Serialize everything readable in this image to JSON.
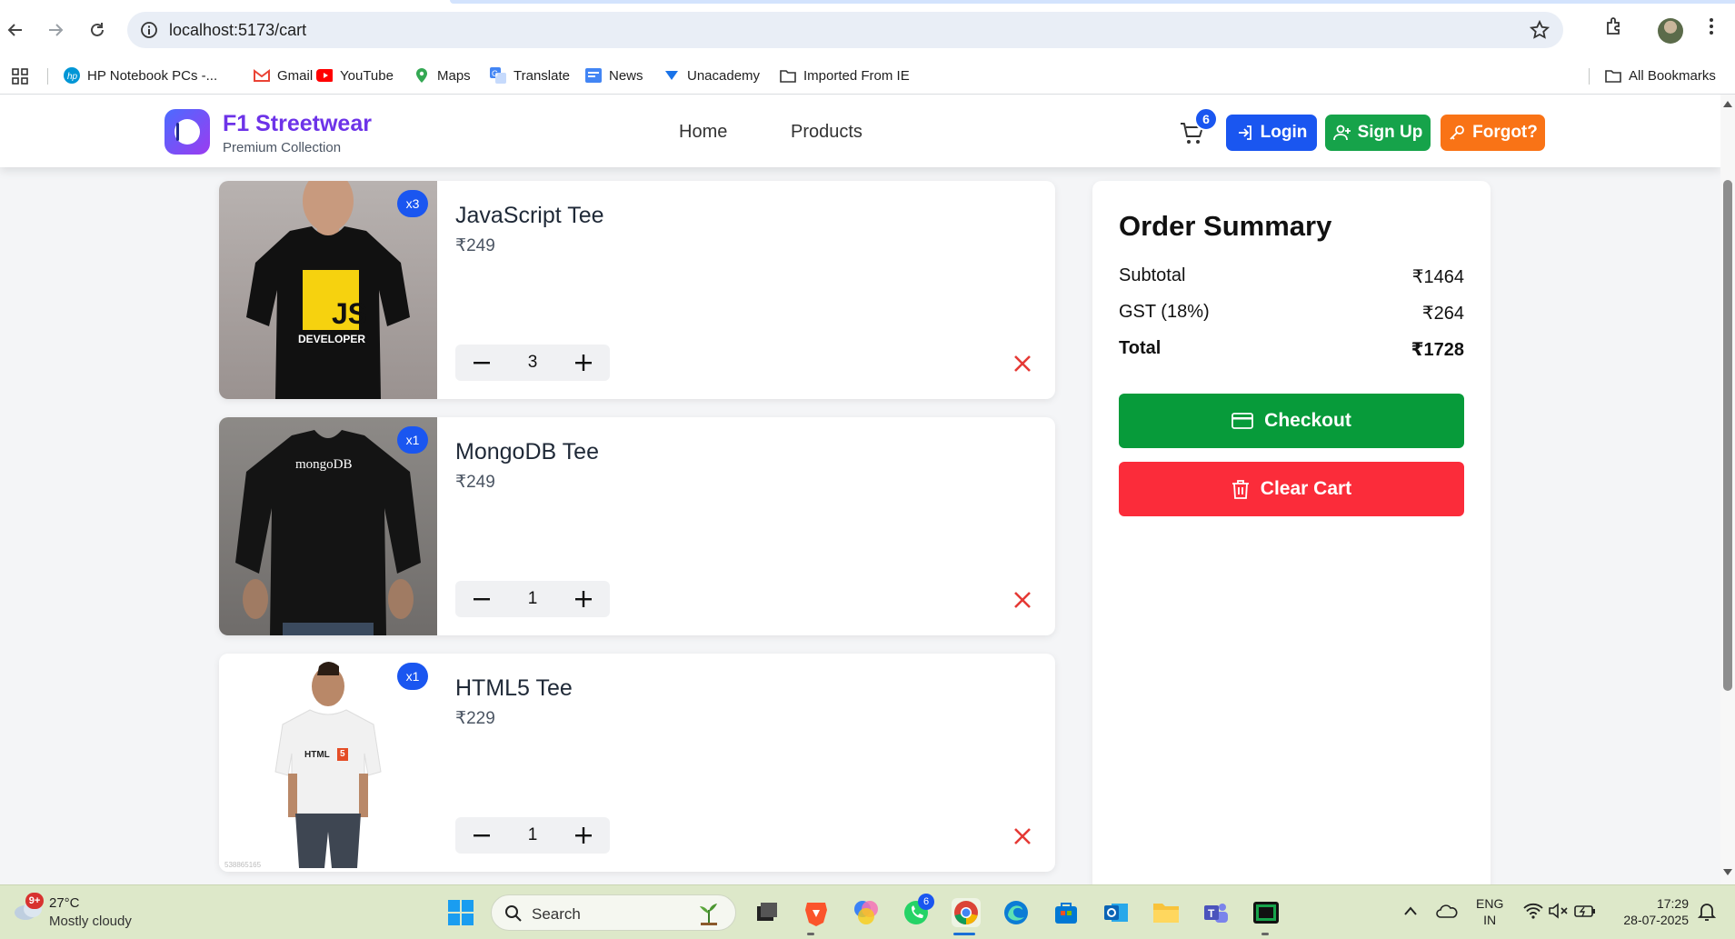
{
  "browser": {
    "url": "localhost:5173/cart",
    "bookmarks": [
      "HP Notebook PCs -...",
      "Gmail",
      "YouTube",
      "Maps",
      "Translate",
      "News",
      "Unacademy",
      "Imported From IE"
    ],
    "all_bookmarks": "All Bookmarks"
  },
  "header": {
    "brand": "F1 Streetwear",
    "tagline": "Premium Collection",
    "nav": [
      "Home",
      "Products"
    ],
    "cart_count": "6",
    "login": "Login",
    "signup": "Sign Up",
    "forgot": "Forgot?",
    "colors": {
      "brand": "#6d33e8",
      "login": "#1a56f0",
      "signup": "#16a34a",
      "forgot": "#f97316"
    }
  },
  "cart": {
    "items": [
      {
        "name": "JavaScript Tee",
        "price": "₹249",
        "qty": "3",
        "badge": "x3",
        "image_text": "JS",
        "image_subtext": "DEVELOPER"
      },
      {
        "name": "MongoDB Tee",
        "price": "₹249",
        "qty": "1",
        "badge": "x1",
        "image_text": "mongoDB"
      },
      {
        "name": "HTML5 Tee",
        "price": "₹229",
        "qty": "1",
        "badge": "x1",
        "image_text": "HTML",
        "image_badge": "5",
        "image_watermark": "538865165"
      }
    ]
  },
  "summary": {
    "title": "Order Summary",
    "subtotal_label": "Subtotal",
    "subtotal": "₹1464",
    "gst_label": "GST (18%)",
    "gst": "₹264",
    "total_label": "Total",
    "total": "₹1728",
    "checkout": "Checkout",
    "clear": "Clear Cart",
    "colors": {
      "checkout": "#079b3a",
      "clear": "#fb2c3a"
    }
  },
  "taskbar": {
    "temp": "27°C",
    "weather": "Mostly cloudy",
    "weather_badge": "9+",
    "search": "Search",
    "whatsapp_badge": "6",
    "lang1": "ENG",
    "lang2": "IN",
    "time": "17:29",
    "date": "28-07-2025"
  }
}
